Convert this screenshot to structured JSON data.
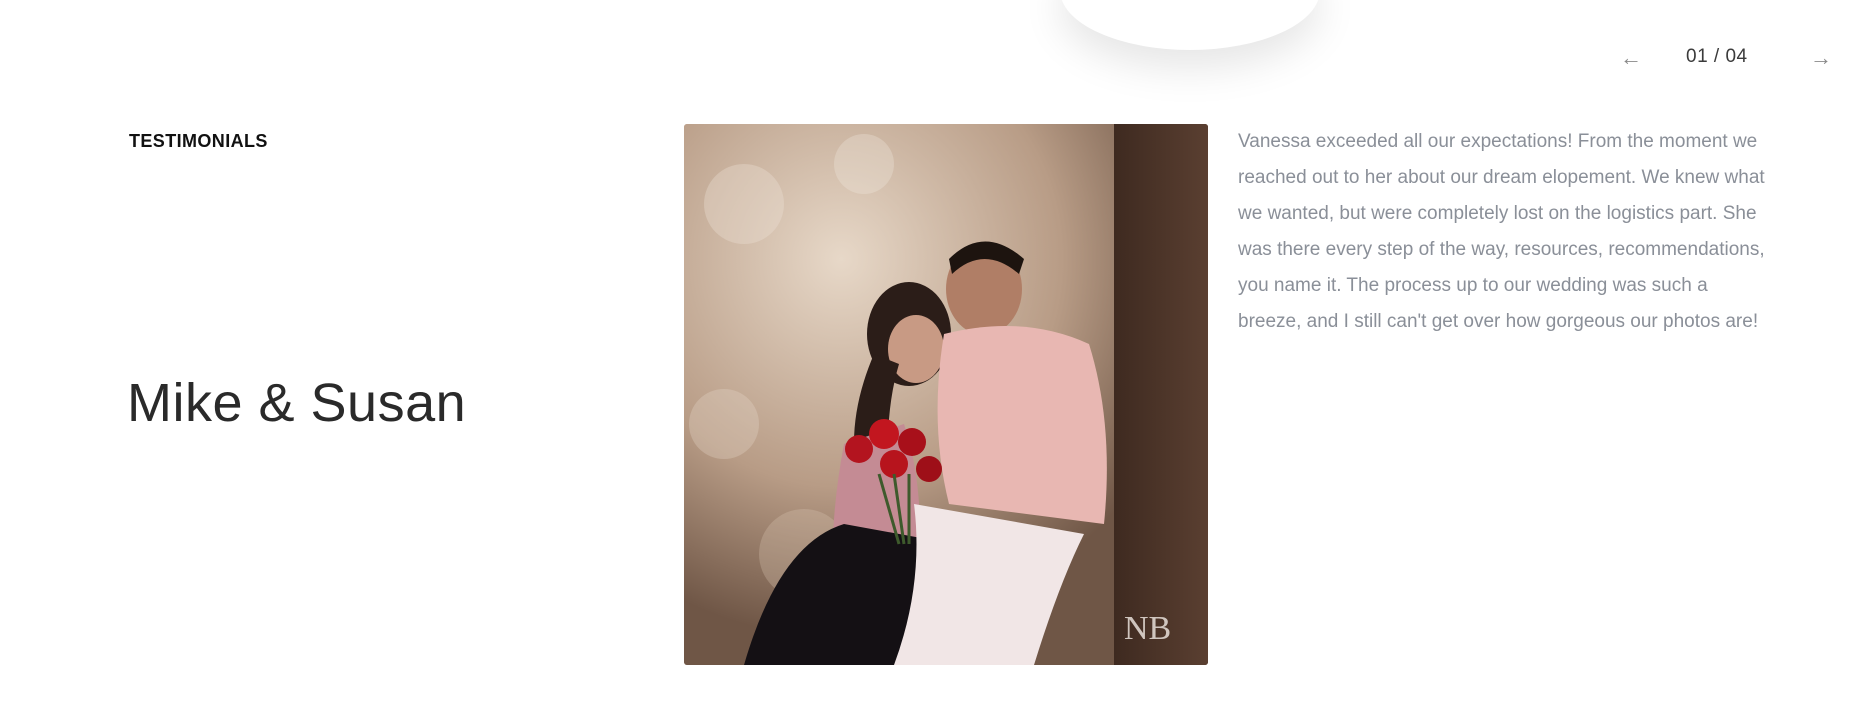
{
  "pager": {
    "prev_icon": "arrow-left-icon",
    "next_icon": "arrow-right-icon",
    "count": "01 / 04"
  },
  "section_label": "TESTIMONIALS",
  "testimonial": {
    "names": "Mike & Susan",
    "quote": "Vanessa exceeded all our expectations! From the moment we reached out to her about our dream elopement. We knew what we wanted, but were completely lost on the logistics part. She was there every step of the way, resources, recommendations, you name it. The process up to our wedding was such a breeze, and I still can't get over how gorgeous our photos are!",
    "photo_watermark": "NB"
  },
  "colors": {
    "heading": "#2a2a2a",
    "quote_text": "#8a8f98",
    "label": "#111111"
  }
}
